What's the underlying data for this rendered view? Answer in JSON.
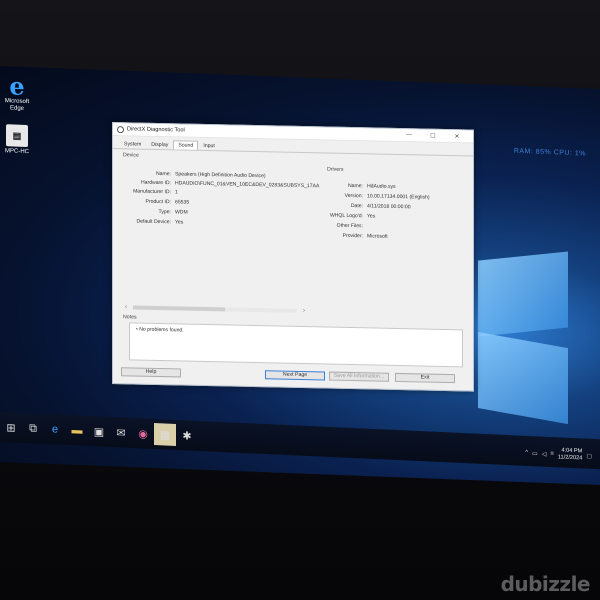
{
  "desktop": {
    "icons": [
      {
        "label1": "Microsoft",
        "label2": "Edge"
      },
      {
        "label1": "MPC-HC",
        "label2": ""
      }
    ],
    "corner_text": "RAM: 85%  CPU: 1%"
  },
  "window": {
    "title": "DirectX Diagnostic Tool",
    "controls": [
      "—",
      "☐",
      "✕"
    ],
    "tabs": [
      {
        "label": "System"
      },
      {
        "label": "Display"
      },
      {
        "label": "Sound"
      },
      {
        "label": "Input"
      }
    ],
    "active_tab": "Sound",
    "device_group": "Device",
    "device": [
      {
        "k": "Name:",
        "v": "Speakers (High Definition Audio Device)"
      },
      {
        "k": "Hardware ID:",
        "v": "HDAUDIO\\FUNC_01&VEN_10EC&DEV_0283&SUBSYS_17AA"
      },
      {
        "k": "Manufacturer ID:",
        "v": "1"
      },
      {
        "k": "Product ID:",
        "v": "65535"
      },
      {
        "k": "Type:",
        "v": "WDM"
      },
      {
        "k": "Default Device:",
        "v": "Yes"
      }
    ],
    "drivers_group": "Drivers",
    "drivers": [
      {
        "k": "Name:",
        "v": "HdAudio.sys"
      },
      {
        "k": "Version:",
        "v": "10.00.17134.0001 (English)"
      },
      {
        "k": "Date:",
        "v": "4/11/2018 00:00:00"
      },
      {
        "k": "WHQL Logo'd:",
        "v": "Yes"
      },
      {
        "k": "Other Files:",
        "v": ""
      },
      {
        "k": "Provider:",
        "v": "Microsoft"
      }
    ],
    "notes_label": "Notes",
    "notes": "No problems found.",
    "buttons": {
      "help": "Help",
      "next": "Next Page",
      "save": "Save All Information...",
      "exit": "Exit"
    }
  },
  "taskbar": {
    "clock_time": "4:04 PM",
    "clock_date": "11/2/2024"
  },
  "watermark": "dubizzle"
}
